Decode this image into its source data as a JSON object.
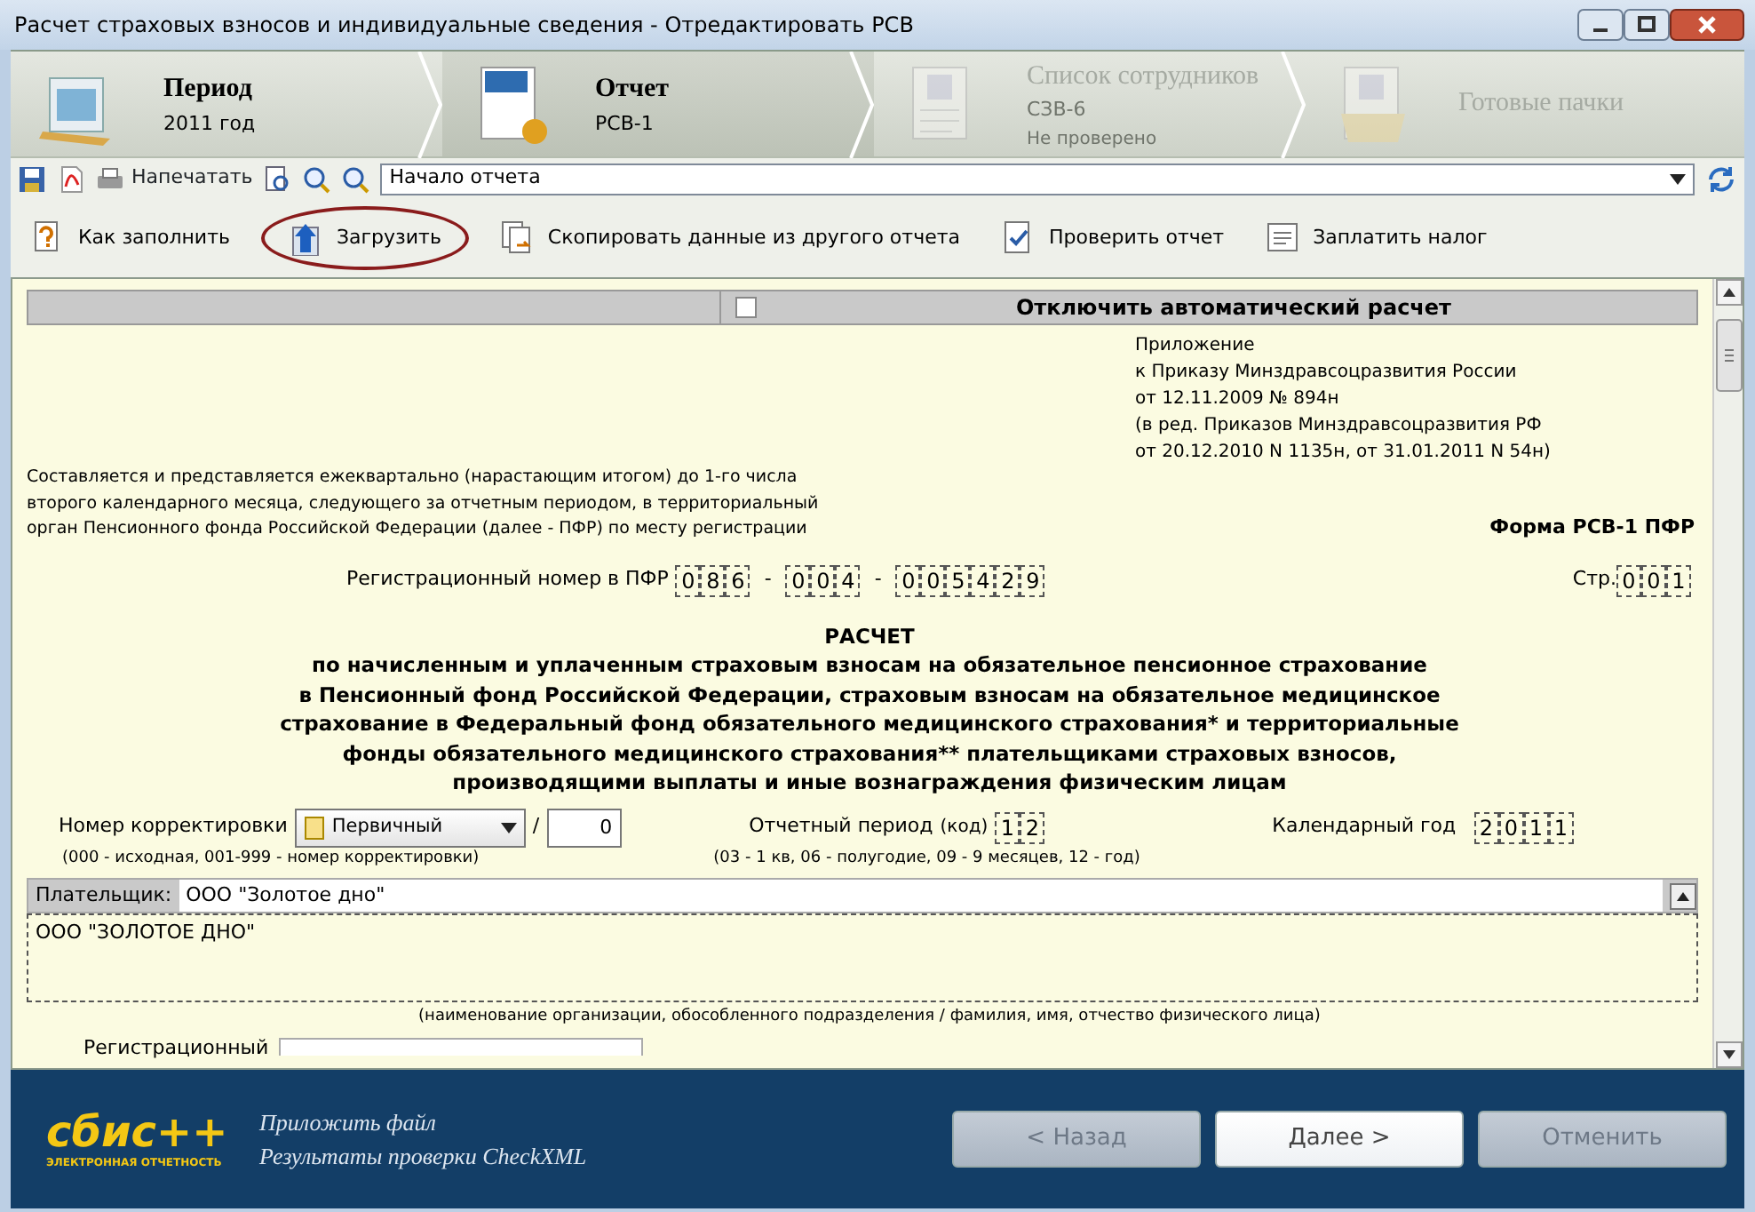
{
  "window": {
    "title": "Расчет страховых взносов и индивидуальные сведения - Отредактировать РСВ"
  },
  "wizard": {
    "steps": [
      {
        "title": "Период",
        "subtitle": "2011 год",
        "selected": false,
        "disabled": false
      },
      {
        "title": "Отчет",
        "subtitle": "РСВ-1",
        "selected": true,
        "disabled": false
      },
      {
        "title": "Список сотрудников",
        "subtitle": "СЗВ-6",
        "note": "Не проверено",
        "selected": false,
        "disabled": true
      },
      {
        "title": "Готовые пачки",
        "selected": false,
        "disabled": true
      }
    ]
  },
  "toolbar": {
    "print_label": "Напечатать",
    "section": "Начало отчета"
  },
  "actions": [
    {
      "kind": "help",
      "label": "Как заполнить",
      "highlighted": false
    },
    {
      "kind": "upload",
      "label": "Загрузить",
      "highlighted": true
    },
    {
      "kind": "copy",
      "label": "Скопировать данные из другого отчета",
      "highlighted": false
    },
    {
      "kind": "check",
      "label": "Проверить отчет",
      "highlighted": false
    },
    {
      "kind": "pay",
      "label": "Заплатить налог",
      "highlighted": false
    }
  ],
  "form": {
    "auto_calc": {
      "label": "Отключить автоматический расчет",
      "checked": false
    },
    "appendix": [
      "Приложение",
      "к Приказу Минздравсоцразвития России",
      "от 12.11.2009 № 894н",
      "(в ред. Приказов Минздравсоцразвития РФ",
      "от 20.12.2010 N 1135н, от 31.01.2011 N 54н)"
    ],
    "intro": [
      "Составляется и представляется ежеквартально (нарастающим итогом) до 1-го числа",
      "второго календарного месяца, следующего за отчетным периодом, в территориальный",
      "орган Пенсионного фонда Российской Федерации (далее - ПФР) по месту регистрации"
    ],
    "form_name": "Форма РСВ-1 ПФР",
    "reg_number": {
      "label": "Регистрационный номер в ПФР",
      "groups": [
        [
          "0",
          "8",
          "6"
        ],
        [
          "0",
          "0",
          "4"
        ],
        [
          "0",
          "0",
          "5",
          "4",
          "2",
          "9"
        ]
      ],
      "separator": "-"
    },
    "page": {
      "label": "Стр.",
      "value": [
        "0",
        "0",
        "1"
      ]
    },
    "title": "РАСЧЕТ",
    "subtitle": [
      "по начисленным и уплаченным страховым взносам на обязательное пенсионное страхование",
      "в Пенсионный фонд Российской Федерации, страховым взносам на обязательное медицинское",
      "страхование в Федеральный фонд обязательного медицинского страхования* и территориальные",
      "фонды обязательного медицинского страхования** плательщиками страховых взносов,",
      "производящими выплаты и иные вознаграждения физическим лицам"
    ],
    "correction": {
      "label": "Номер корректировки",
      "type": "Первичный",
      "slash": "/",
      "value": "0",
      "hint": "(000 - исходная, 001-999 - номер корректировки)"
    },
    "period": {
      "label": "Отчетный период",
      "code_label": "(код)",
      "value": [
        "1",
        "2"
      ],
      "hint": "(03 - 1 кв, 06 - полугодие, 09 - 9 месяцев, 12 - год)"
    },
    "year": {
      "label": "Календарный год",
      "value": [
        "2",
        "0",
        "1",
        "1"
      ]
    },
    "payer": {
      "label": "Плательщик:",
      "value": "ООО \"Золотое дно\"",
      "full_name": "ООО \"ЗОЛОТОЕ ДНО\"",
      "caption": "(наименование организации, обособленного подразделения / фамилия, имя, отчество физического лица)"
    },
    "next_label": "Регистрационный"
  },
  "footer": {
    "logo": "сбис++",
    "logo_caption": "ЭЛЕКТРОННАЯ ОТЧЕТНОСТЬ",
    "links": [
      "Приложить файл",
      "Результаты проверки CheckXML"
    ],
    "buttons": [
      {
        "label": "< Назад",
        "disabled": true
      },
      {
        "label": "Далее >",
        "disabled": false
      },
      {
        "label": "Отменить",
        "disabled": true
      }
    ]
  }
}
